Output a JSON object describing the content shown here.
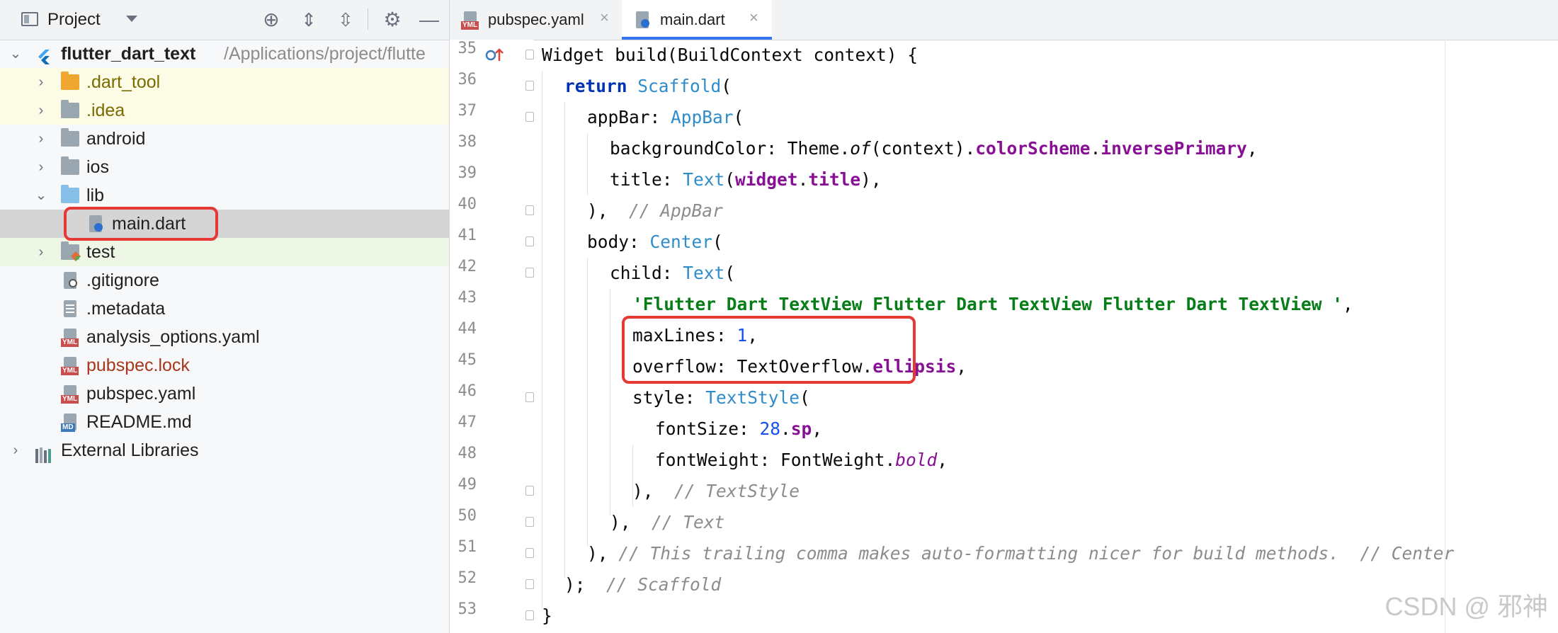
{
  "project_panel": {
    "title": "Project",
    "root": {
      "name": "flutter_dart_text",
      "path": "/Applications/project/flutte"
    },
    "items": [
      {
        "label": ".dart_tool",
        "depth": 1,
        "type": "folder",
        "expandable": true,
        "color": "#f0a732",
        "label_color": "#7b6a00"
      },
      {
        "label": ".idea",
        "depth": 1,
        "type": "folder",
        "expandable": true,
        "color": "#9aa7b0",
        "label_color": "#7b6a00"
      },
      {
        "label": "android",
        "depth": 1,
        "type": "folder",
        "expandable": true,
        "color": "#9aa7b0"
      },
      {
        "label": "ios",
        "depth": 1,
        "type": "folder",
        "expandable": true,
        "color": "#9aa7b0"
      },
      {
        "label": "lib",
        "depth": 1,
        "type": "folder",
        "expanded": true,
        "color": "#87bfe8"
      },
      {
        "label": "main.dart",
        "depth": 2,
        "type": "dart",
        "selected": true
      },
      {
        "label": "test",
        "depth": 1,
        "type": "folder",
        "expandable": true,
        "color": "#9aa7b0"
      },
      {
        "label": ".gitignore",
        "depth": 1,
        "type": "file"
      },
      {
        "label": ".metadata",
        "depth": 1,
        "type": "file"
      },
      {
        "label": "analysis_options.yaml",
        "depth": 1,
        "type": "yml"
      },
      {
        "label": "pubspec.lock",
        "depth": 1,
        "type": "yml",
        "label_color": "#a8361b"
      },
      {
        "label": "pubspec.yaml",
        "depth": 1,
        "type": "yml"
      },
      {
        "label": "README.md",
        "depth": 1,
        "type": "md"
      }
    ],
    "external": "External Libraries",
    "badges": {
      "yml": "YML",
      "md": "MD"
    }
  },
  "editor": {
    "tabs": [
      {
        "label": "pubspec.yaml",
        "active": false
      },
      {
        "label": "main.dart",
        "active": true
      }
    ],
    "line_numbers": [
      "35",
      "36",
      "37",
      "38",
      "39",
      "40",
      "41",
      "42",
      "43",
      "44",
      "45",
      "46",
      "47",
      "48",
      "49",
      "50",
      "51",
      "52",
      "53"
    ]
  },
  "watermark": "CSDN @ 邪神"
}
